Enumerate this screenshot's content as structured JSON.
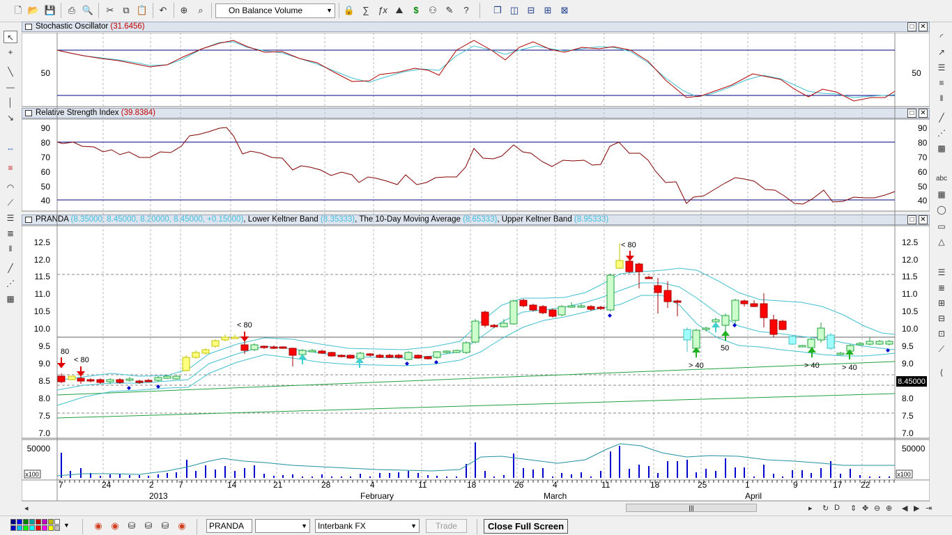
{
  "toolbar": {
    "indicator_select": "On Balance Volume",
    "icons": [
      "new-icon",
      "open-icon",
      "save-icon",
      "print-icon",
      "print-preview-icon",
      "cut-icon",
      "copy-icon",
      "paste-icon",
      "undo-icon",
      "crosshair-icon",
      "zoom-icon",
      "lock-icon",
      "function-icon",
      "fx-icon",
      "chart-icon",
      "dollar-icon",
      "binoculars-icon",
      "edit-icon",
      "help-icon",
      "window-cascade-icon",
      "window-tile-vertical-icon",
      "window-tile-horizontal-icon",
      "window-grid-icon",
      "window-arrange-icon"
    ]
  },
  "panes": {
    "stochastic": {
      "title": "Stochastic Oscillator",
      "value": "(31.6456)",
      "left_tick": "50",
      "right_tick": "50"
    },
    "rsi": {
      "title": "Relative Strength Index",
      "value": "(39.8384)",
      "ticks": [
        "90",
        "80",
        "70",
        "60",
        "50",
        "40"
      ]
    },
    "price": {
      "title": "PRANDA",
      "ohlc": "(8.35000, 8.45000, 8.20000, 8.45000, +0.15000)",
      "lower_keltner_label": "Lower Keltner Band",
      "lower_keltner_value": "(8.35333)",
      "ma_label": "The 10-Day Moving Average",
      "ma_value": "(8.65333)",
      "upper_keltner_label": "Upper Keltner Band",
      "upper_keltner_value": "(8.95333)",
      "ticks": [
        "12.5",
        "12.0",
        "11.5",
        "11.0",
        "10.5",
        "10.0",
        "9.5",
        "9.0",
        "8.5",
        "8.0",
        "7.5",
        "7.0"
      ],
      "last_price": "8.45000",
      "annotations": [
        "80",
        "< 80",
        "< 80",
        "< 80",
        "> 40",
        "50",
        "> 40",
        "> 40"
      ]
    },
    "volume": {
      "tick": "50000",
      "scale_label": "x100"
    }
  },
  "x_axis": {
    "day_labels": [
      "7",
      "24",
      "2",
      "7",
      "14",
      "21",
      "28",
      "4",
      "11",
      "18",
      "26",
      "4",
      "11",
      "18",
      "25",
      "1",
      "9",
      "17",
      "22"
    ],
    "month_labels": [
      "2013",
      "February",
      "March",
      "April"
    ]
  },
  "bottom_bar": {
    "symbol": "PRANDA",
    "empty_select": "",
    "feed_select": "Interbank FX",
    "trade_label": "Trade",
    "close_fullscreen_label": "Close Full Screen"
  },
  "colors": {
    "pane_header_bg": "#dde4ee",
    "bull_candle": "#90ee90",
    "bear_candle": "#ff0000",
    "keltner": "#40c0d0",
    "trend": "#20a040",
    "line_red": "#b00000",
    "volume_bar": "#0000cc"
  }
}
